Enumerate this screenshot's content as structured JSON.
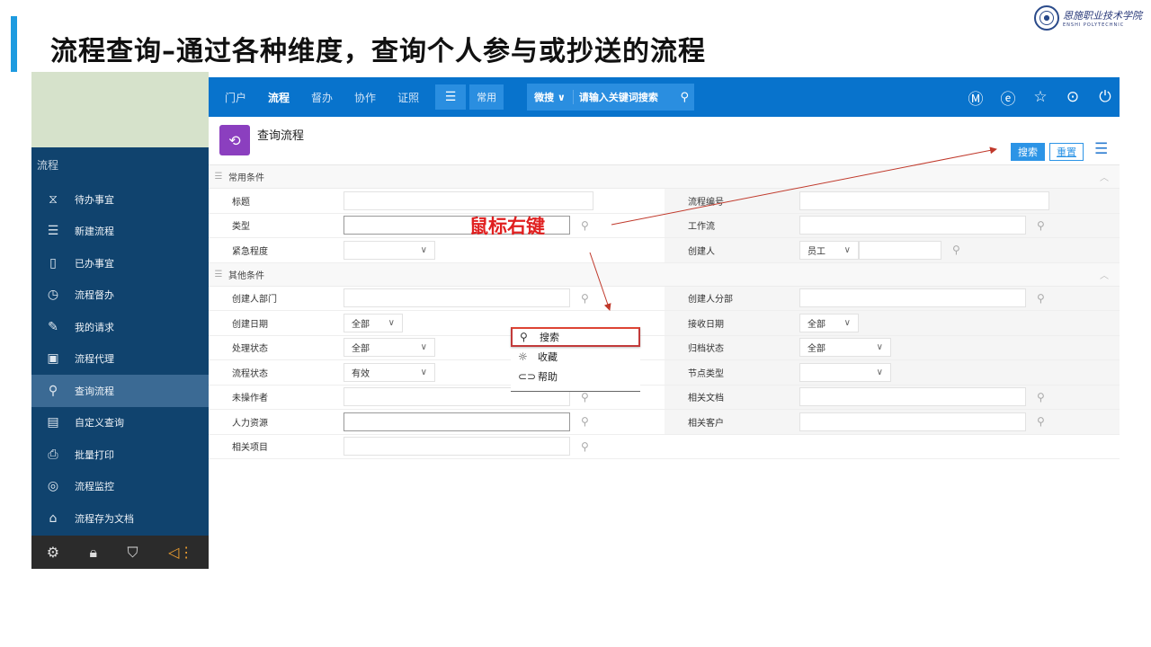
{
  "slide": {
    "title": "流程查询–通过各种维度，查询个人参与或抄送的流程",
    "annotation": "鼠标右键"
  },
  "logo": {
    "cn": "恩施职业技术学院",
    "en": "ENSHI POLYTECHNIC"
  },
  "sidebar": {
    "section": "流程",
    "items": [
      {
        "label": "待办事宜",
        "icon": "hourglass-icon"
      },
      {
        "label": "新建流程",
        "icon": "new-doc-icon"
      },
      {
        "label": "已办事宜",
        "icon": "done-doc-icon"
      },
      {
        "label": "流程督办",
        "icon": "clock-icon"
      },
      {
        "label": "我的请求",
        "icon": "edit-icon"
      },
      {
        "label": "流程代理",
        "icon": "agent-icon"
      },
      {
        "label": "查询流程",
        "icon": "search-icon"
      },
      {
        "label": "自定义查询",
        "icon": "list-doc-icon"
      },
      {
        "label": "批量打印",
        "icon": "print-icon"
      },
      {
        "label": "流程监控",
        "icon": "monitor-icon"
      },
      {
        "label": "流程存为文档",
        "icon": "archive-icon"
      }
    ],
    "active_index": 6
  },
  "topnav": {
    "items": [
      "门户",
      "流程",
      "督办",
      "协作",
      "证照"
    ],
    "active": "流程",
    "common": "常用",
    "search_type": "微搜",
    "search_placeholder": "请输入关键词搜索"
  },
  "page": {
    "title": "查询流程",
    "btn_search": "搜索",
    "btn_reset": "重置"
  },
  "sections": {
    "common": "常用条件",
    "other": "其他条件"
  },
  "fields": {
    "title": "标题",
    "flow_no": "流程编号",
    "type": "类型",
    "workflow": "工作流",
    "urgency": "紧急程度",
    "creator": "创建人",
    "creator_type": "员工",
    "creator_dept": "创建人部门",
    "creator_branch": "创建人分部",
    "create_date": "创建日期",
    "create_date_val": "全部",
    "receive_date": "接收日期",
    "receive_date_val": "全部",
    "process_status": "处理状态",
    "process_status_val": "全部",
    "archive_status": "归档状态",
    "archive_status_val": "全部",
    "flow_status": "流程状态",
    "flow_status_val": "有效",
    "node_type": "节点类型",
    "not_operator": "未操作者",
    "related_doc": "相关文档",
    "hr": "人力资源",
    "related_customer": "相关客户",
    "related_project": "相关项目"
  },
  "context_menu": {
    "items": [
      "搜索",
      "收藏",
      "帮助"
    ]
  },
  "colors": {
    "accent_bar": "#1E9BE0",
    "topnav": "#0873CC",
    "sidebar": "#10436E",
    "annotation": "#E02020"
  }
}
